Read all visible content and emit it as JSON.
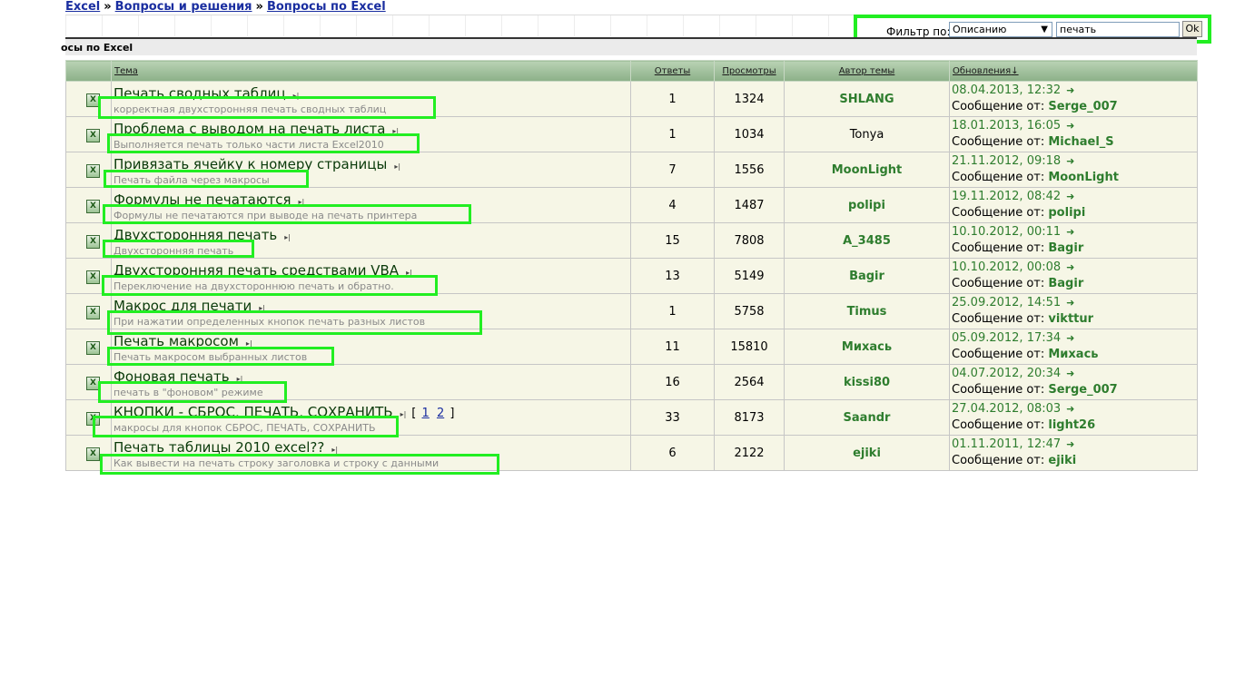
{
  "breadcrumb": {
    "items": [
      "Excel",
      "Вопросы и решения",
      "Вопросы по Excel"
    ],
    "separator": "»"
  },
  "filter": {
    "label": "Фильтр по:",
    "select_value": "Описанию",
    "input_value": "печать",
    "button_label": "Ok"
  },
  "section": {
    "title": "осы по Excel"
  },
  "table": {
    "headers": {
      "topic": "Тема",
      "replies": "Ответы",
      "views": "Просмотры",
      "author": "Автор темы",
      "updates": "Обновления"
    },
    "posted_by_label": "Сообщение от:",
    "rows": [
      {
        "title": "Печать сводных таблиц",
        "description": "корректная двухсторонняя печать сводных таблиц",
        "replies": "1",
        "views": "1324",
        "author": "SHLANG",
        "date": "08.04.2013, 12:32",
        "last_by": "Serge_007"
      },
      {
        "title": "Проблема с выводом на печать листа",
        "description": "Выполняется печать только части листа Excel2010",
        "replies": "1",
        "views": "1034",
        "author": "Tonya",
        "date": "18.01.2013, 16:05",
        "last_by": "Michael_S"
      },
      {
        "title": "Привязать ячейку к номеру страницы",
        "description": "Печать файла через макросы",
        "replies": "7",
        "views": "1556",
        "author": "MoonLight",
        "date": "21.11.2012, 09:18",
        "last_by": "MoonLight"
      },
      {
        "title": "Формулы не печатаются",
        "description": "Формулы не печатаются при выводе на печать принтера",
        "replies": "4",
        "views": "1487",
        "author": "polipi",
        "date": "19.11.2012, 08:42",
        "last_by": "polipi"
      },
      {
        "title": "Двухсторонняя печать",
        "description": "Двухсторонняя печать",
        "replies": "15",
        "views": "7808",
        "author": "A_3485",
        "date": "10.10.2012, 00:11",
        "last_by": "Bagir"
      },
      {
        "title": "Двухсторонняя печать средствами VBA",
        "description": "Переключение на двухстороннюю печать и обратно.",
        "replies": "13",
        "views": "5149",
        "author": "Bagir",
        "date": "10.10.2012, 00:08",
        "last_by": "Bagir"
      },
      {
        "title": "Макрос для печати",
        "description": "При нажатии определенных кнопок печать разных листов",
        "replies": "1",
        "views": "5758",
        "author": "Timus",
        "date": "25.09.2012, 14:51",
        "last_by": "vikttur"
      },
      {
        "title": "Печать макросом",
        "description": "Печать макросом выбранных листов",
        "replies": "11",
        "views": "15810",
        "author": "Михась",
        "date": "05.09.2012, 17:34",
        "last_by": "Михась"
      },
      {
        "title": "Фоновая печать",
        "description": "печать в \"фоновом\" режиме",
        "replies": "16",
        "views": "2564",
        "author": "kissi80",
        "date": "04.07.2012, 20:34",
        "last_by": "Serge_007"
      },
      {
        "title": "КНОПКИ - СБРОС, ПЕЧАТЬ, СОХРАНИТЬ",
        "description": "макросы для кнопок СБРОС, ПЕЧАТЬ, СОХРАНИТЬ",
        "replies": "33",
        "views": "8173",
        "author": "Saandr",
        "date": "27.04.2012, 08:03",
        "last_by": "light26",
        "pages": [
          "1",
          "2"
        ]
      },
      {
        "title": "Печать таблицы 2010 excel??",
        "description": "Как вывести на печать строку заголовка и строку с данными",
        "replies": "6",
        "views": "2122",
        "author": "ejiki",
        "date": "01.11.2011, 12:47",
        "last_by": "ejiki"
      }
    ]
  }
}
